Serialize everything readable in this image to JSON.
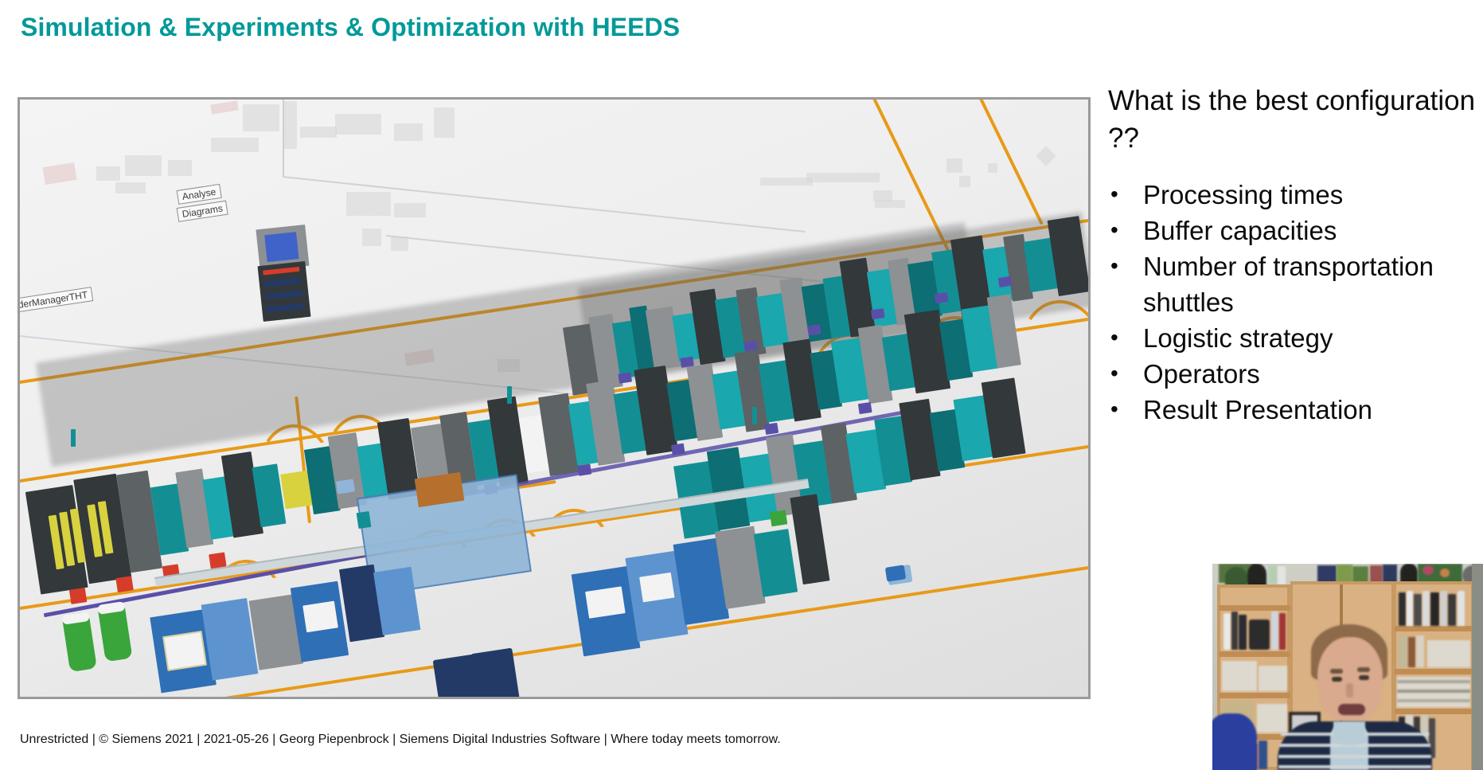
{
  "slide": {
    "title": "Simulation & Experiments & Optimization with HEEDS",
    "title_color": "#009999"
  },
  "figure": {
    "alt": "3D plant simulation model of an electronics assembly line with AGV paths",
    "labels": [
      "derManagerTHT",
      "Analyse",
      "Diagrams"
    ]
  },
  "content": {
    "question": "What is the best configuration ??",
    "bullets": [
      "Processing times",
      "Buffer capacities",
      "Number of transportation shuttles",
      "Logistic strategy",
      "Operators",
      "Result Presentation"
    ]
  },
  "footer": {
    "text": "Unrestricted | © Siemens 2021 | 2021-05-26 | Georg Piepenbrock | Siemens Digital Industries Software | Where today meets tomorrow."
  },
  "webcam": {
    "alt": "Presenter webcam video feed in front of a bookshelf"
  }
}
